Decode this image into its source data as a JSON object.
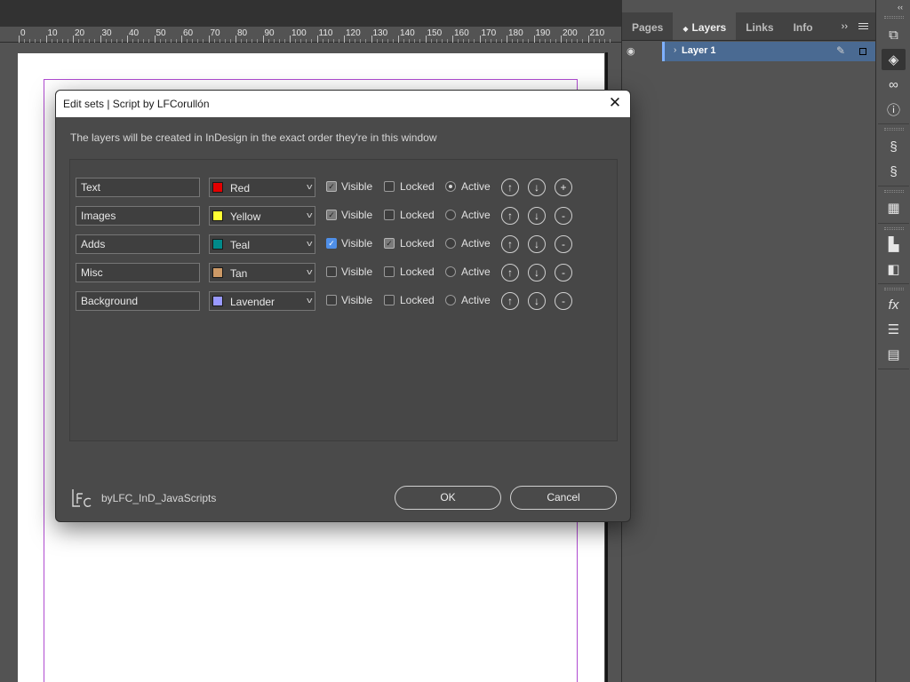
{
  "ruler": {
    "labels": [
      "0",
      "10",
      "20",
      "30",
      "40",
      "50",
      "60",
      "70",
      "80",
      "90",
      "100",
      "110",
      "120",
      "130",
      "140",
      "150",
      "160",
      "170",
      "180",
      "190",
      "200",
      "210"
    ]
  },
  "panel": {
    "tabs": [
      {
        "label": "Pages",
        "active": false
      },
      {
        "label": "Layers",
        "active": true
      },
      {
        "label": "Links",
        "active": false
      },
      {
        "label": "Info",
        "active": false
      }
    ],
    "more_icon": "››",
    "layer": {
      "name": "Layer 1",
      "color": "#4a6a92"
    }
  },
  "tools": {
    "collapse_icon": "‹‹",
    "icons": [
      "pages-icon",
      "layers-icon",
      "links-icon",
      "info-icon",
      "stroke-icon",
      "swatches-icon",
      "table-icon",
      "align-icon",
      "pathfinder-icon",
      "effects-icon",
      "lines-icon",
      "text-wrap-icon"
    ]
  },
  "dialog": {
    "title": "Edit sets | Script by LFCorullón",
    "close_icon": "✕",
    "instruction": "The layers will be created in InDesign in the exact order they're in this window",
    "visible_label": "Visible",
    "locked_label": "Locked",
    "active_label": "Active",
    "up_icon": "↑",
    "down_icon": "↓",
    "rows": [
      {
        "name": "Text",
        "color_name": "Red",
        "color": "#e30000",
        "visible": true,
        "visible_blue": false,
        "locked": false,
        "active": true,
        "action": "+"
      },
      {
        "name": "Images",
        "color_name": "Yellow",
        "color": "#ffff33",
        "visible": true,
        "visible_blue": false,
        "locked": false,
        "active": false,
        "action": "-"
      },
      {
        "name": "Adds",
        "color_name": "Teal",
        "color": "#008a8a",
        "visible": true,
        "visible_blue": true,
        "locked": true,
        "active": false,
        "action": "-"
      },
      {
        "name": "Misc",
        "color_name": "Tan",
        "color": "#cc9966",
        "visible": false,
        "visible_blue": false,
        "locked": false,
        "active": false,
        "action": "-"
      },
      {
        "name": "Background",
        "color_name": "Lavender",
        "color": "#9999ff",
        "visible": false,
        "visible_blue": false,
        "locked": false,
        "active": false,
        "action": "-"
      }
    ],
    "footer_text": "byLFC_InD_JavaScripts",
    "ok_label": "OK",
    "cancel_label": "Cancel"
  }
}
